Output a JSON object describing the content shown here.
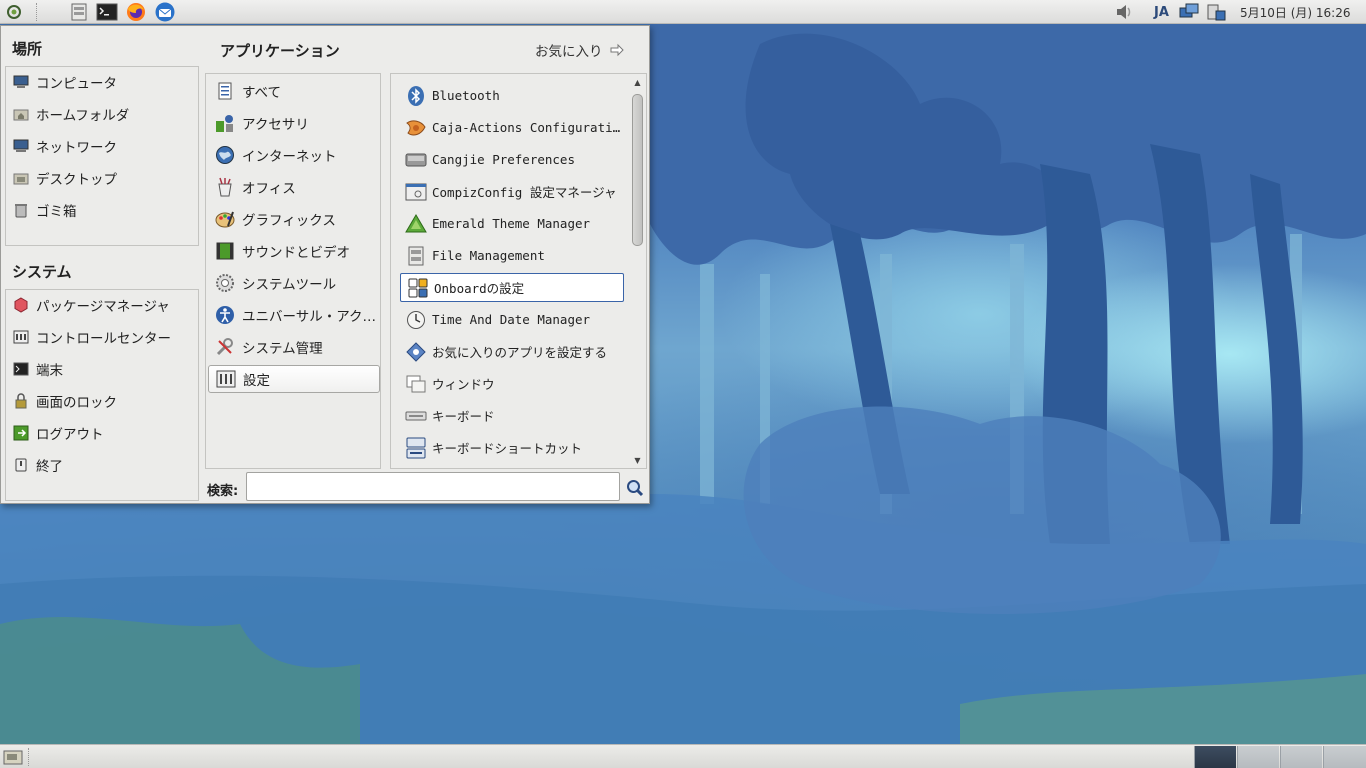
{
  "top_panel": {
    "language": "JA",
    "clock": "5月10日 (月) 16:26",
    "launchers": [
      "menu-icon",
      "file-manager-icon",
      "terminal-icon",
      "firefox-icon",
      "thunderbird-icon"
    ]
  },
  "menu": {
    "places": {
      "title": "場所",
      "items": [
        {
          "label": "コンピュータ",
          "icon": "computer-icon"
        },
        {
          "label": "ホームフォルダ",
          "icon": "home-folder-icon"
        },
        {
          "label": "ネットワーク",
          "icon": "network-icon"
        },
        {
          "label": "デスクトップ",
          "icon": "desktop-folder-icon"
        },
        {
          "label": "ゴミ箱",
          "icon": "trash-icon"
        }
      ]
    },
    "system": {
      "title": "システム",
      "items": [
        {
          "label": "パッケージマネージャ",
          "icon": "package-icon"
        },
        {
          "label": "コントロールセンター",
          "icon": "control-center-icon"
        },
        {
          "label": "端末",
          "icon": "terminal-icon"
        },
        {
          "label": "画面のロック",
          "icon": "lock-screen-icon"
        },
        {
          "label": "ログアウト",
          "icon": "logout-icon"
        },
        {
          "label": "終了",
          "icon": "shutdown-icon"
        }
      ]
    },
    "applications": {
      "title": "アプリケーション",
      "favorites_label": "お気に入り",
      "categories": [
        {
          "label": "すべて",
          "icon": "all-apps-icon"
        },
        {
          "label": "アクセサリ",
          "icon": "accessories-icon"
        },
        {
          "label": "インターネット",
          "icon": "internet-icon"
        },
        {
          "label": "オフィス",
          "icon": "office-icon"
        },
        {
          "label": "グラフィックス",
          "icon": "graphics-icon"
        },
        {
          "label": "サウンドとビデオ",
          "icon": "multimedia-icon"
        },
        {
          "label": "システムツール",
          "icon": "system-tools-icon"
        },
        {
          "label": "ユニバーサル・アク…",
          "icon": "accessibility-icon"
        },
        {
          "label": "システム管理",
          "icon": "administration-icon"
        },
        {
          "label": "設定",
          "icon": "settings-icon",
          "selected": true
        }
      ],
      "apps": [
        {
          "label": "Bluetooth",
          "icon": "bluetooth-icon"
        },
        {
          "label": "Caja-Actions Configuratio…",
          "icon": "caja-actions-icon"
        },
        {
          "label": "Cangjie Preferences",
          "icon": "cangjie-icon"
        },
        {
          "label": "CompizConfig 設定マネージャ",
          "icon": "compizconfig-icon"
        },
        {
          "label": "Emerald Theme Manager",
          "icon": "emerald-icon"
        },
        {
          "label": "File Management",
          "icon": "file-management-icon"
        },
        {
          "label": "Onboardの設定",
          "icon": "onboard-icon",
          "selected": true
        },
        {
          "label": "Time And Date Manager",
          "icon": "clock-icon"
        },
        {
          "label": "お気に入りのアプリを設定する",
          "icon": "favorite-apps-icon"
        },
        {
          "label": "ウィンドウ",
          "icon": "window-icon"
        },
        {
          "label": "キーボード",
          "icon": "keyboard-icon"
        },
        {
          "label": "キーボードショートカット",
          "icon": "keyboard-shortcut-icon"
        }
      ]
    },
    "search": {
      "label": "検索:",
      "value": "",
      "placeholder": ""
    }
  },
  "bottom_panel": {
    "workspaces": 4,
    "active_workspace": 1
  }
}
